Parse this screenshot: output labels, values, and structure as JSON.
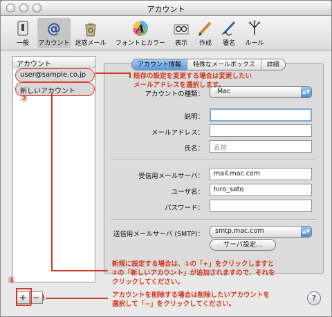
{
  "window": {
    "title": "アカウント"
  },
  "toolbar": {
    "items": [
      {
        "label": "一般",
        "icon": "switch-icon"
      },
      {
        "label": "アカウント",
        "icon": "at-sign-icon",
        "selected": true
      },
      {
        "label": "迷惑メール",
        "icon": "recycle-bin-icon"
      },
      {
        "label": "フォントとカラー",
        "icon": "font-color-icon"
      },
      {
        "label": "表示",
        "icon": "glasses-icon"
      },
      {
        "label": "作成",
        "icon": "compose-pencil-icon"
      },
      {
        "label": "署名",
        "icon": "signature-pen-icon"
      },
      {
        "label": "ルール",
        "icon": "rules-icon"
      }
    ]
  },
  "accounts": {
    "header": "アカウント",
    "items": [
      "user@sample.co.jp",
      "新しいアカウント"
    ],
    "add_label": "+",
    "remove_label": "−"
  },
  "tabs": [
    "アカウント情報",
    "特殊なメールボックス",
    "詳細"
  ],
  "form": {
    "type_label": "アカウントの種類：",
    "type_value": ".Mac",
    "desc_label": "説明：",
    "desc_value": "",
    "email_label": "メールアドレス：",
    "email_value": "",
    "name_label": "氏名：",
    "name_placeholder": "名前",
    "incoming_label": "受信用メールサーバ：",
    "incoming_value": "mail.mac.com",
    "user_label": "ユーザ名：",
    "user_value": "hiro_sato",
    "password_label": "パスワード：",
    "password_value": "",
    "smtp_label": "送信用メールサーバ (SMTP)：",
    "smtp_value": "smtp.mac.com",
    "server_settings_button": "サーバ設定..."
  },
  "help_label": "?",
  "annotations": {
    "existing_line1": "既存の設定を変更する場合は変更したい",
    "existing_line2": "メールアドレスを選択します。",
    "new_line1": "新規に設定する場合は、①の「+」をクリックしますと",
    "new_line2": "②の「新しいアカウント」が追加されますので、それを",
    "new_line3": "クリックしてください。",
    "delete_line1": "アカウントを削除する場合は削除したいアカウントを",
    "delete_line2": "選択して「−」をクリックしてください。",
    "num1": "①",
    "num2": "②"
  },
  "colors": {
    "annotation": "#d03a20",
    "accent": "#5a99dc"
  }
}
